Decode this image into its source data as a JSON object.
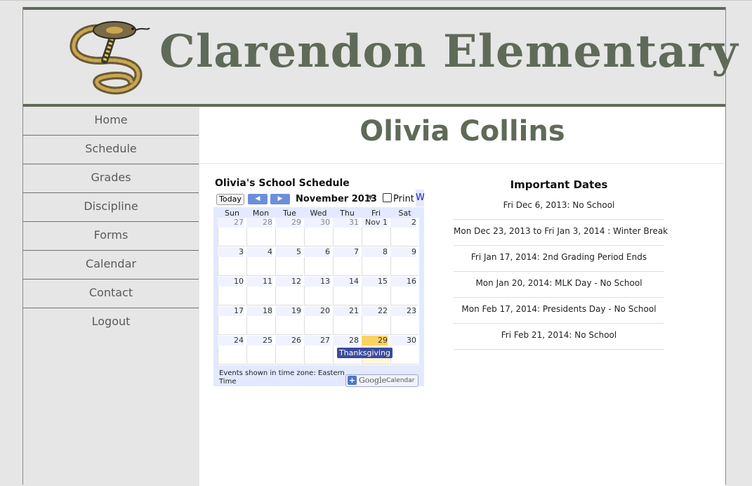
{
  "header": {
    "school_name": "Clarendon Elementary",
    "logo_icon": "cobra-snake-logo"
  },
  "sidebar": {
    "items": [
      {
        "label": "Home"
      },
      {
        "label": "Schedule"
      },
      {
        "label": "Grades"
      },
      {
        "label": "Discipline"
      },
      {
        "label": "Forms"
      },
      {
        "label": "Calendar"
      },
      {
        "label": "Contact"
      },
      {
        "label": "Logout"
      }
    ]
  },
  "main": {
    "student_name": "Olivia Collins"
  },
  "calendar": {
    "title": "Olivia's School Schedule",
    "today_label": "Today",
    "month_label": "November 2013",
    "print_label": "Print",
    "week_tab_label": "W",
    "weekdays": [
      "Sun",
      "Mon",
      "Tue",
      "Wed",
      "Thu",
      "Fri",
      "Sat"
    ],
    "weeks": [
      [
        "27",
        "28",
        "29",
        "30",
        "31",
        "Nov 1",
        "2"
      ],
      [
        "3",
        "4",
        "5",
        "6",
        "7",
        "8",
        "9"
      ],
      [
        "10",
        "11",
        "12",
        "13",
        "14",
        "15",
        "16"
      ],
      [
        "17",
        "18",
        "19",
        "20",
        "21",
        "22",
        "23"
      ],
      [
        "24",
        "25",
        "26",
        "27",
        "28",
        "29",
        "30"
      ]
    ],
    "today_date": "29",
    "event_label": "Thanksgiving",
    "timezone_note": "Events shown in time zone: Eastern Time",
    "google_badge": {
      "brand": "Google",
      "product": "Calendar"
    },
    "colors": {
      "accent": "#6d8fdb",
      "event": "#3a4a9e",
      "today": "#fad163",
      "background": "#e3e9ff"
    }
  },
  "important_dates": {
    "title": "Important Dates",
    "items": [
      "Fri Dec 6, 2013: No School",
      "Mon Dec 23, 2013 to Fri Jan 3, 2014  : Winter Break",
      "Fri Jan 17, 2014: 2nd Grading Period Ends",
      "Mon Jan 20, 2014: MLK Day - No School",
      "Mon Feb 17, 2014: Presidents Day - No School",
      "Fri Feb 21, 2014: No School"
    ]
  },
  "colors": {
    "brand": "#5f6a58",
    "page_background": "#e6e6e6",
    "content_background": "#ffffff"
  }
}
